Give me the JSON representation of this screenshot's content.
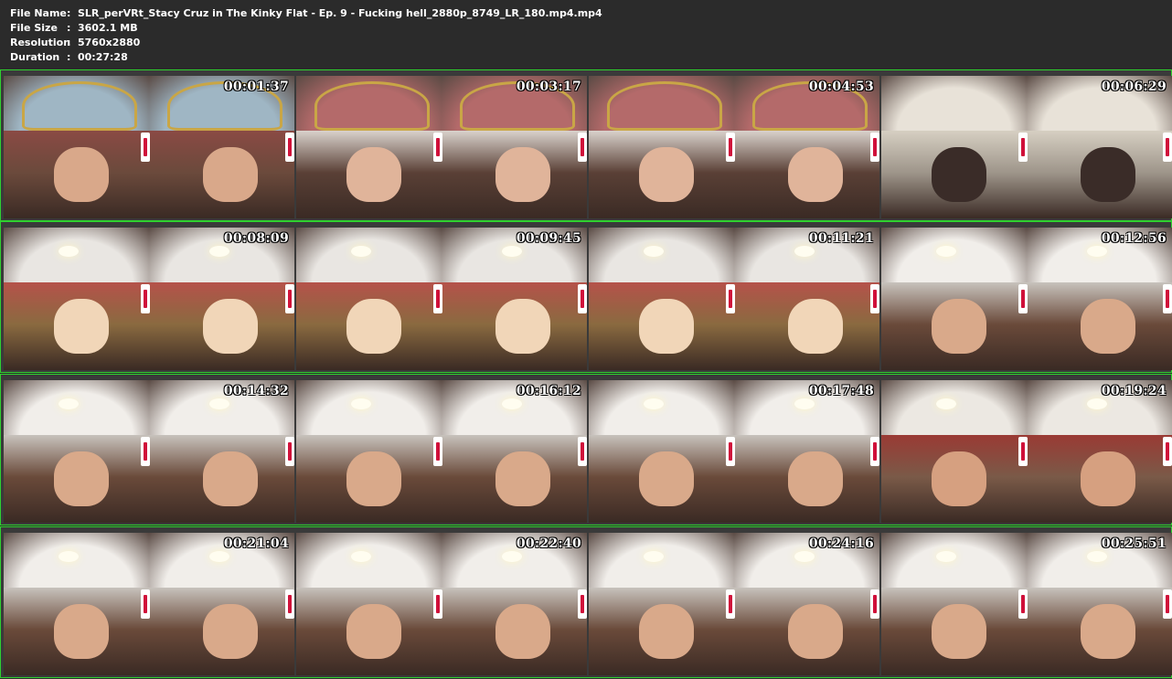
{
  "info": {
    "file_name_label": "File Name",
    "file_name": "SLR_perVRt_Stacy Cruz in The Kinky Flat - Ep. 9 - Fucking hell_2880p_8749_LR_180.mp4.mp4",
    "file_size_label": "File Size",
    "file_size": "3602.1 MB",
    "resolution_label": "Resolution",
    "resolution": "5760x2880",
    "duration_label": "Duration",
    "duration": "00:27:28",
    "separator": ":"
  },
  "colors": {
    "background": "#2b2b2b",
    "strip_border": "#2fd12f",
    "text": "#ffffff"
  },
  "rows": [
    {
      "thumbs": [
        {
          "time": "00:01:37",
          "scene": "ornate-ceiling-painting"
        },
        {
          "time": "00:03:17",
          "scene": "red-damask-ceiling"
        },
        {
          "time": "00:04:53",
          "scene": "red-damask-ceiling"
        },
        {
          "time": "00:06:29",
          "scene": "bathroom"
        }
      ]
    },
    {
      "thumbs": [
        {
          "time": "00:08:09",
          "scene": "red-room-cross"
        },
        {
          "time": "00:09:45",
          "scene": "red-room-cross"
        },
        {
          "time": "00:11:21",
          "scene": "red-room-cross"
        },
        {
          "time": "00:12:56",
          "scene": "canopy-bed"
        }
      ]
    },
    {
      "thumbs": [
        {
          "time": "00:14:32",
          "scene": "canopy-bed"
        },
        {
          "time": "00:16:12",
          "scene": "canopy-bed"
        },
        {
          "time": "00:17:48",
          "scene": "canopy-bed"
        },
        {
          "time": "00:19:24",
          "scene": "arched-room"
        }
      ]
    },
    {
      "thumbs": [
        {
          "time": "00:21:04",
          "scene": "canopy-bed"
        },
        {
          "time": "00:22:40",
          "scene": "canopy-bed"
        },
        {
          "time": "00:24:16",
          "scene": "canopy-bed"
        },
        {
          "time": "00:25:51",
          "scene": "canopy-bed"
        }
      ]
    }
  ]
}
